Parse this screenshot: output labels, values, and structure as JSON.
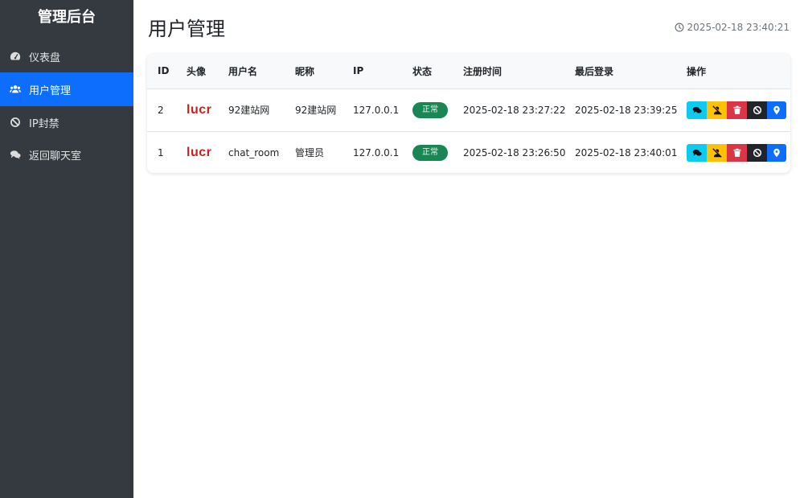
{
  "sidebar": {
    "brand": "管理后台",
    "items": [
      {
        "label": "仪表盘",
        "icon": "gauge-icon",
        "active": false
      },
      {
        "label": "用户管理",
        "icon": "users-icon",
        "active": true
      },
      {
        "label": "IP封禁",
        "icon": "ban-icon",
        "active": false
      },
      {
        "label": "返回聊天室",
        "icon": "comments-icon",
        "active": false
      }
    ]
  },
  "header": {
    "title": "用户管理",
    "datetime": "2025-02-18 23:40:21",
    "clock_icon": "clock-icon"
  },
  "table": {
    "headers": [
      "ID",
      "头像",
      "用户名",
      "昵称",
      "IP",
      "状态",
      "注册时间",
      "最后登录",
      "操作"
    ],
    "rows": [
      {
        "id": "2",
        "avatar_text": "lucr",
        "username": "92建站网",
        "nickname": "92建站网",
        "ip": "127.0.0.1",
        "status": "正常",
        "registered": "2025-02-18 23:27:22",
        "last_login": "2025-02-18 23:39:25"
      },
      {
        "id": "1",
        "avatar_text": "lucr",
        "username": "chat_room",
        "nickname": "管理员",
        "ip": "127.0.0.1",
        "status": "正常",
        "registered": "2025-02-18 23:26:50",
        "last_login": "2025-02-18 23:40:01"
      }
    ],
    "action_icons": [
      "comments-icon",
      "mute-user-icon",
      "trash-icon",
      "ban-icon",
      "map-marker-icon"
    ]
  },
  "colors": {
    "sidebar_bg": "#343a40",
    "active": "#0d6efd",
    "status_ok": "#198754",
    "btn_chat": "#0dcaf0",
    "btn_mute": "#ffc107",
    "btn_delete": "#dc3545",
    "btn_ban": "#212529",
    "btn_location": "#0d6efd"
  }
}
